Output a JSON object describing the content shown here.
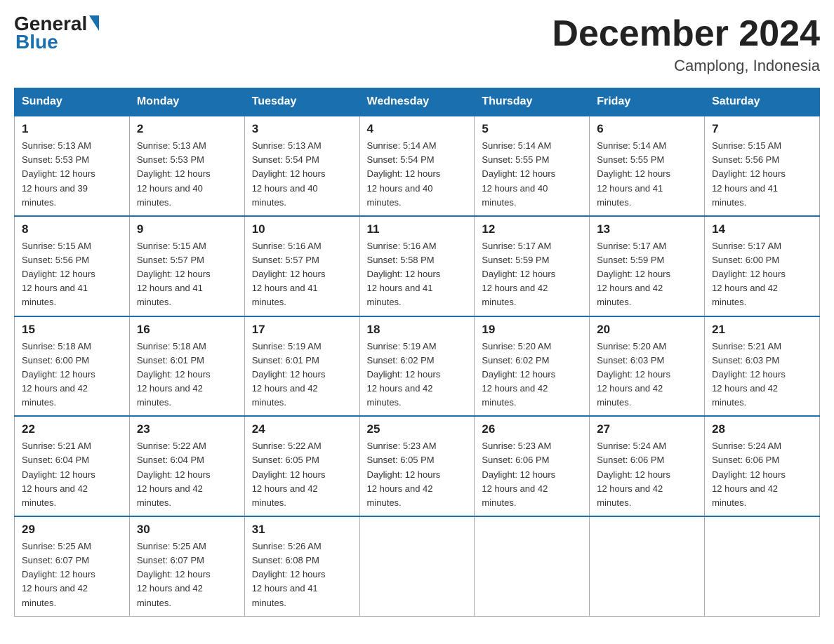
{
  "header": {
    "logo_general": "General",
    "logo_blue": "Blue",
    "title": "December 2024",
    "location": "Camplong, Indonesia"
  },
  "days_of_week": [
    "Sunday",
    "Monday",
    "Tuesday",
    "Wednesday",
    "Thursday",
    "Friday",
    "Saturday"
  ],
  "weeks": [
    [
      {
        "day": "1",
        "sunrise": "5:13 AM",
        "sunset": "5:53 PM",
        "daylight": "12 hours and 39 minutes."
      },
      {
        "day": "2",
        "sunrise": "5:13 AM",
        "sunset": "5:53 PM",
        "daylight": "12 hours and 40 minutes."
      },
      {
        "day": "3",
        "sunrise": "5:13 AM",
        "sunset": "5:54 PM",
        "daylight": "12 hours and 40 minutes."
      },
      {
        "day": "4",
        "sunrise": "5:14 AM",
        "sunset": "5:54 PM",
        "daylight": "12 hours and 40 minutes."
      },
      {
        "day": "5",
        "sunrise": "5:14 AM",
        "sunset": "5:55 PM",
        "daylight": "12 hours and 40 minutes."
      },
      {
        "day": "6",
        "sunrise": "5:14 AM",
        "sunset": "5:55 PM",
        "daylight": "12 hours and 41 minutes."
      },
      {
        "day": "7",
        "sunrise": "5:15 AM",
        "sunset": "5:56 PM",
        "daylight": "12 hours and 41 minutes."
      }
    ],
    [
      {
        "day": "8",
        "sunrise": "5:15 AM",
        "sunset": "5:56 PM",
        "daylight": "12 hours and 41 minutes."
      },
      {
        "day": "9",
        "sunrise": "5:15 AM",
        "sunset": "5:57 PM",
        "daylight": "12 hours and 41 minutes."
      },
      {
        "day": "10",
        "sunrise": "5:16 AM",
        "sunset": "5:57 PM",
        "daylight": "12 hours and 41 minutes."
      },
      {
        "day": "11",
        "sunrise": "5:16 AM",
        "sunset": "5:58 PM",
        "daylight": "12 hours and 41 minutes."
      },
      {
        "day": "12",
        "sunrise": "5:17 AM",
        "sunset": "5:59 PM",
        "daylight": "12 hours and 42 minutes."
      },
      {
        "day": "13",
        "sunrise": "5:17 AM",
        "sunset": "5:59 PM",
        "daylight": "12 hours and 42 minutes."
      },
      {
        "day": "14",
        "sunrise": "5:17 AM",
        "sunset": "6:00 PM",
        "daylight": "12 hours and 42 minutes."
      }
    ],
    [
      {
        "day": "15",
        "sunrise": "5:18 AM",
        "sunset": "6:00 PM",
        "daylight": "12 hours and 42 minutes."
      },
      {
        "day": "16",
        "sunrise": "5:18 AM",
        "sunset": "6:01 PM",
        "daylight": "12 hours and 42 minutes."
      },
      {
        "day": "17",
        "sunrise": "5:19 AM",
        "sunset": "6:01 PM",
        "daylight": "12 hours and 42 minutes."
      },
      {
        "day": "18",
        "sunrise": "5:19 AM",
        "sunset": "6:02 PM",
        "daylight": "12 hours and 42 minutes."
      },
      {
        "day": "19",
        "sunrise": "5:20 AM",
        "sunset": "6:02 PM",
        "daylight": "12 hours and 42 minutes."
      },
      {
        "day": "20",
        "sunrise": "5:20 AM",
        "sunset": "6:03 PM",
        "daylight": "12 hours and 42 minutes."
      },
      {
        "day": "21",
        "sunrise": "5:21 AM",
        "sunset": "6:03 PM",
        "daylight": "12 hours and 42 minutes."
      }
    ],
    [
      {
        "day": "22",
        "sunrise": "5:21 AM",
        "sunset": "6:04 PM",
        "daylight": "12 hours and 42 minutes."
      },
      {
        "day": "23",
        "sunrise": "5:22 AM",
        "sunset": "6:04 PM",
        "daylight": "12 hours and 42 minutes."
      },
      {
        "day": "24",
        "sunrise": "5:22 AM",
        "sunset": "6:05 PM",
        "daylight": "12 hours and 42 minutes."
      },
      {
        "day": "25",
        "sunrise": "5:23 AM",
        "sunset": "6:05 PM",
        "daylight": "12 hours and 42 minutes."
      },
      {
        "day": "26",
        "sunrise": "5:23 AM",
        "sunset": "6:06 PM",
        "daylight": "12 hours and 42 minutes."
      },
      {
        "day": "27",
        "sunrise": "5:24 AM",
        "sunset": "6:06 PM",
        "daylight": "12 hours and 42 minutes."
      },
      {
        "day": "28",
        "sunrise": "5:24 AM",
        "sunset": "6:06 PM",
        "daylight": "12 hours and 42 minutes."
      }
    ],
    [
      {
        "day": "29",
        "sunrise": "5:25 AM",
        "sunset": "6:07 PM",
        "daylight": "12 hours and 42 minutes."
      },
      {
        "day": "30",
        "sunrise": "5:25 AM",
        "sunset": "6:07 PM",
        "daylight": "12 hours and 42 minutes."
      },
      {
        "day": "31",
        "sunrise": "5:26 AM",
        "sunset": "6:08 PM",
        "daylight": "12 hours and 41 minutes."
      },
      null,
      null,
      null,
      null
    ]
  ]
}
